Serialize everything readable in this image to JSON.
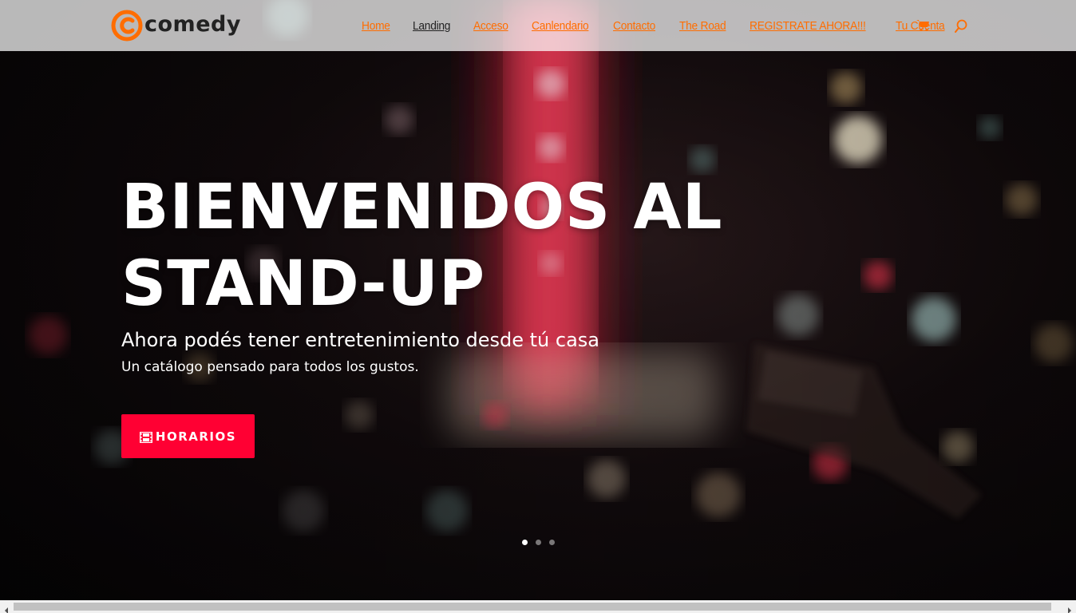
{
  "brand": {
    "name": "comedy",
    "accent": "#ff6d00"
  },
  "nav": {
    "items": [
      {
        "label": "Home",
        "current": false
      },
      {
        "label": "Landing",
        "current": true
      },
      {
        "label": "Acceso",
        "current": false
      },
      {
        "label": "Canlendario",
        "current": false
      },
      {
        "label": "Contacto",
        "current": false
      },
      {
        "label": "The Road",
        "current": false
      },
      {
        "label": "REGISTRATE AHORA!!!",
        "current": false
      },
      {
        "label": "Tu Cuenta",
        "current": false
      }
    ],
    "cart_icon": "shopping-cart-icon",
    "search_icon": "search-icon"
  },
  "hero": {
    "title": "BIENVENIDOS AL STAND-UP",
    "subtitle": "Ahora podés tener entretenimiento desde tú casa",
    "text": "Un catálogo pensado para todos los gustos.",
    "button": {
      "label": "HORARIOS",
      "icon": "film-icon",
      "color": "#ff0033"
    },
    "slider": {
      "count": 3,
      "active": 1
    }
  }
}
